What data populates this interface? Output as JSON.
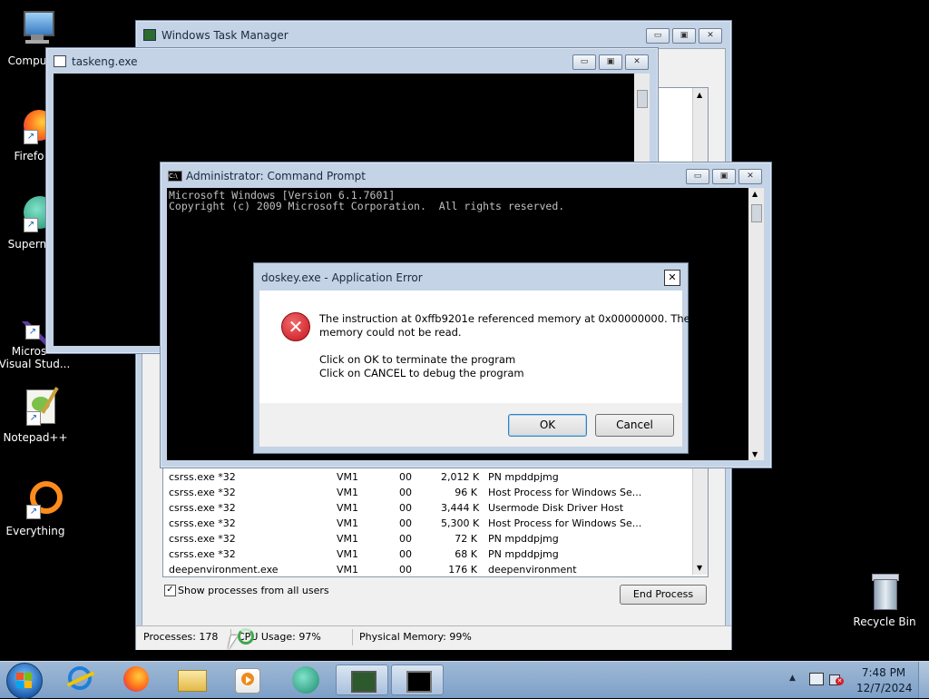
{
  "desktop": {
    "icons": [
      {
        "label": "Compu"
      },
      {
        "label": "Firefo"
      },
      {
        "label": "Superm"
      },
      {
        "label": "Micros",
        "label2": "Visual Stud..."
      },
      {
        "label": "Notepad++"
      },
      {
        "label": "Everything"
      }
    ],
    "recycle_bin": "Recycle Bin"
  },
  "task_manager": {
    "title": "Windows Task Manager",
    "processes": [
      {
        "name": "csrss.exe *32",
        "user": "VM1",
        "cpu": "00",
        "mem": "2,012 K",
        "desc": "PN mpddpjmg"
      },
      {
        "name": "csrss.exe *32",
        "user": "VM1",
        "cpu": "00",
        "mem": "96 K",
        "desc": "Host Process for Windows Se..."
      },
      {
        "name": "csrss.exe *32",
        "user": "VM1",
        "cpu": "00",
        "mem": "3,444 K",
        "desc": "Usermode Disk Driver Host"
      },
      {
        "name": "csrss.exe *32",
        "user": "VM1",
        "cpu": "00",
        "mem": "5,300 K",
        "desc": "Host Process for Windows Se..."
      },
      {
        "name": "csrss.exe *32",
        "user": "VM1",
        "cpu": "00",
        "mem": "72 K",
        "desc": "PN mpddpjmg"
      },
      {
        "name": "csrss.exe *32",
        "user": "VM1",
        "cpu": "00",
        "mem": "68 K",
        "desc": "PN mpddpjmg"
      },
      {
        "name": "deepenvironment.exe",
        "user": "VM1",
        "cpu": "00",
        "mem": "176 K",
        "desc": "deepenvironment"
      }
    ],
    "show_all_label": "Show processes from all users",
    "show_all_checked": true,
    "end_process_label": "End Process",
    "status": {
      "processes": "Processes: 178",
      "cpu": "CPU Usage: 97%",
      "memory": "Physical Memory: 99%"
    }
  },
  "taskeng": {
    "title": "taskeng.exe"
  },
  "cmd": {
    "title": "Administrator:  Command Prompt",
    "line1": "Microsoft Windows [Version 6.1.7601]",
    "line2": "Copyright (c) 2009 Microsoft Corporation.  All rights reserved."
  },
  "dialog": {
    "title": "doskey.exe - Application Error",
    "message1": "The instruction at 0xffb9201e referenced memory at 0x00000000. The",
    "message2": "memory could not be read.",
    "message3": "Click on OK to terminate the program",
    "message4": "Click on CANCEL to debug the program",
    "ok_label": "OK",
    "cancel_label": "Cancel",
    "close_glyph": "✕"
  },
  "window_controls": {
    "minimize": "▭",
    "maximize": "▣",
    "close": "✕"
  },
  "taskbar": {
    "time": "7:48 PM",
    "date": "12/7/2024"
  },
  "colors": {
    "error_red": "#d0202a",
    "taskbar": "#8fafd2",
    "window_frame": "#c4d3e6"
  }
}
